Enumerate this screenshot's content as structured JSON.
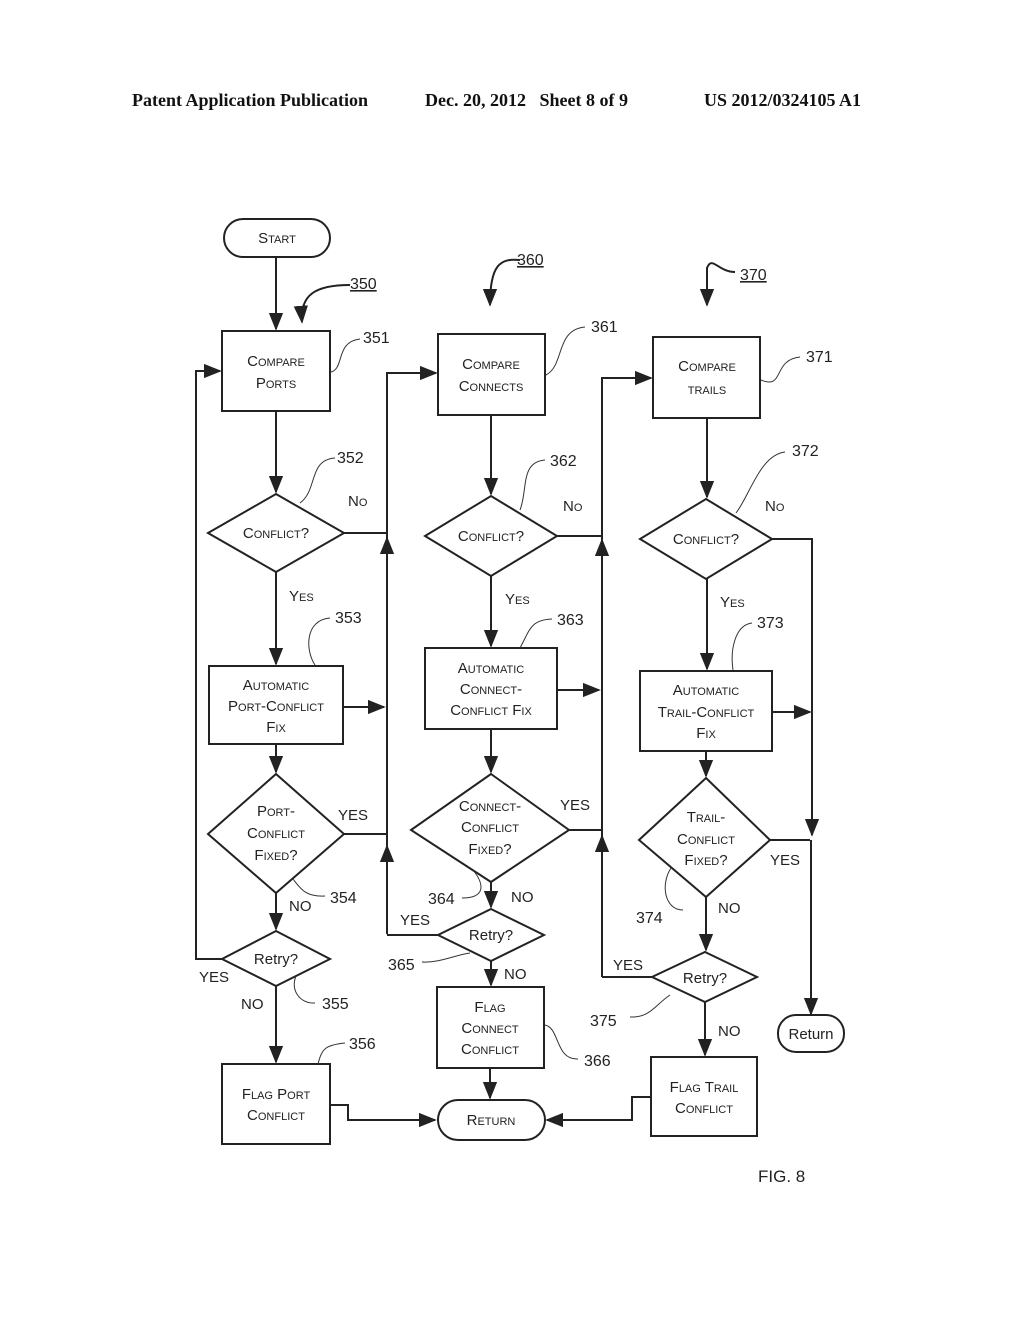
{
  "header": {
    "publication": "Patent Application Publication",
    "date_sheet": "Dec. 20, 2012   Sheet 8 of 9",
    "number": "US 2012/0324105 A1"
  },
  "figure_label": "FIG. 8",
  "flow_refs": {
    "left": "350",
    "middle": "360",
    "right": "370"
  },
  "nodes": {
    "start": {
      "label": "Start"
    },
    "n351": {
      "ref": "351",
      "lines": [
        "Compare",
        "Ports"
      ]
    },
    "n352": {
      "ref": "352",
      "lines": [
        "Conflict?"
      ]
    },
    "n353": {
      "ref": "353",
      "lines": [
        "Automatic",
        "Port-Conflict",
        "Fix"
      ]
    },
    "n354": {
      "ref": "354",
      "lines": [
        "Port-",
        "Conflict",
        "Fixed?"
      ]
    },
    "n355": {
      "ref": "355",
      "lines": [
        "Retry?"
      ]
    },
    "n356": {
      "ref": "356",
      "lines": [
        "Flag Port",
        "Conflict"
      ]
    },
    "n361": {
      "ref": "361",
      "lines": [
        "Compare",
        "Connects"
      ]
    },
    "n362": {
      "ref": "362",
      "lines": [
        "Conflict?"
      ]
    },
    "n363": {
      "ref": "363",
      "lines": [
        "Automatic",
        "Connect-",
        "Conflict Fix"
      ]
    },
    "n364": {
      "ref": "364",
      "lines": [
        "Connect-",
        "Conflict",
        "Fixed?"
      ]
    },
    "n365": {
      "ref": "365",
      "lines": [
        "Retry?"
      ]
    },
    "n366": {
      "ref": "366",
      "lines": [
        "Flag",
        "Connect",
        "Conflict"
      ]
    },
    "n371": {
      "ref": "371",
      "lines": [
        "Compare",
        "trails"
      ]
    },
    "n372": {
      "ref": "372",
      "lines": [
        "Conflict?"
      ]
    },
    "n373": {
      "ref": "373",
      "lines": [
        "Automatic",
        "Trail-Conflict",
        "Fix"
      ]
    },
    "n374": {
      "ref": "374",
      "lines": [
        "Trail-",
        "Conflict",
        "Fixed?"
      ]
    },
    "n375": {
      "ref": "375",
      "lines": [
        "Retry?"
      ]
    },
    "n376": {
      "lines": [
        "Flag Trail",
        "Conflict"
      ]
    },
    "return_main": {
      "label": "Return"
    },
    "return_right": {
      "label": "Return"
    }
  },
  "edge_labels": {
    "yes_cap": "Yes",
    "no_cap": "No",
    "yes_upper": "YES",
    "no_upper": "NO"
  }
}
